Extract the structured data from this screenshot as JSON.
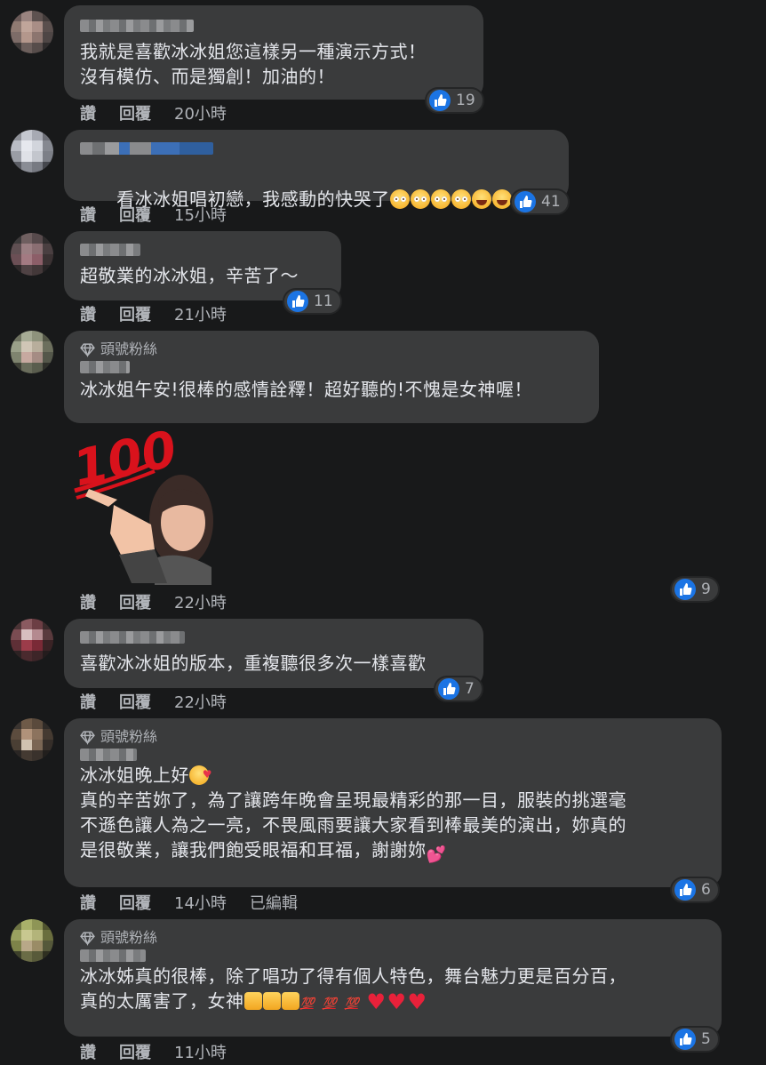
{
  "actions": {
    "like": "讚",
    "reply": "回覆",
    "edited": "已編輯"
  },
  "badge": {
    "top_fan": "頭號粉絲",
    "icon": "diamond-icon"
  },
  "comments": [
    {
      "text": "我就是喜歡冰冰姐您這樣另一種演示方式！\n沒有模仿、而是獨創！加油的！",
      "time": "20小時",
      "reactions": "19"
    },
    {
      "text": "看冰冰姐唱初戀，我感動的快哭了",
      "time": "15小時",
      "reactions": "41",
      "emojis": [
        "pleading-face",
        "pleading-face",
        "pleading-face",
        "pleading-face",
        "laughing-face",
        "laughing-face",
        "laughing-face"
      ]
    },
    {
      "text": "超敬業的冰冰姐，辛苦了～",
      "time": "21小時",
      "reactions": "11"
    },
    {
      "text": "冰冰姐午安!很棒的感情詮釋！超好聽的!不愧是女神喔！",
      "time": "22小時",
      "reactions": "9",
      "top_fan": true,
      "sticker": "avatar-pointing-100-sticker",
      "sticker_text": "100"
    },
    {
      "text": "喜歡冰冰姐的版本，重複聽很多次一樣喜歡",
      "time": "22小時",
      "reactions": "7"
    },
    {
      "line1": "冰冰姐晚上好",
      "text": "真的辛苦妳了，為了讓跨年晚會呈現最精彩的那一目，服裝的挑選毫\n不遜色讓人為之一亮，不畏風雨要讓大家看到棒最美的演出，妳真的\n是很敬業，讓我們飽受眼福和耳福，謝謝妳",
      "time": "14小時",
      "reactions": "6",
      "top_fan": true,
      "edited": true
    },
    {
      "text": "冰冰姊真的很棒，除了唱功了得有個人特色，舞台魅力更是百分百，\n真的太厲害了，女神",
      "time": "11小時",
      "reactions": "5",
      "top_fan": true,
      "emoji_100": "💯"
    }
  ],
  "colors": {
    "background": "#18191a",
    "bubble": "#3a3b3c",
    "like_blue": "#1b74e4",
    "secondary_text": "#b0b3b8"
  }
}
